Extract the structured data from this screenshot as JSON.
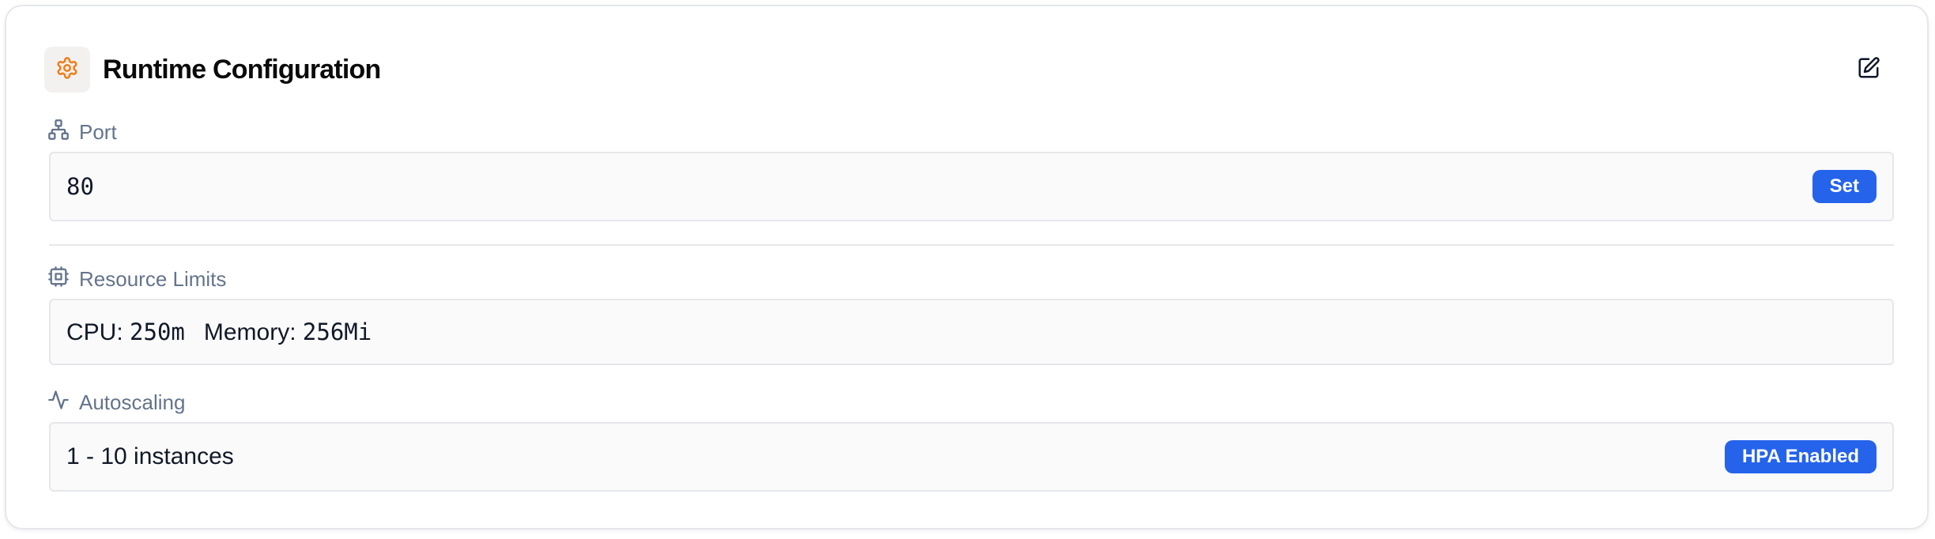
{
  "header": {
    "title": "Runtime Configuration",
    "icon": "gear-icon",
    "edit_icon": "edit-icon"
  },
  "port": {
    "label": "Port",
    "icon": "network-icon",
    "value": "80",
    "action_label": "Set"
  },
  "resources": {
    "label": "Resource Limits",
    "icon": "cpu-icon",
    "cpu_label": "CPU:",
    "cpu_value": "250m",
    "memory_label": "Memory:",
    "memory_value": "256Mi"
  },
  "autoscaling": {
    "label": "Autoscaling",
    "icon": "activity-icon",
    "value": "1 - 10 instances",
    "badge": "HPA Enabled"
  },
  "colors": {
    "accent": "#2563eb",
    "icon_orange": "#f07d16",
    "label_gray": "#64748b"
  }
}
